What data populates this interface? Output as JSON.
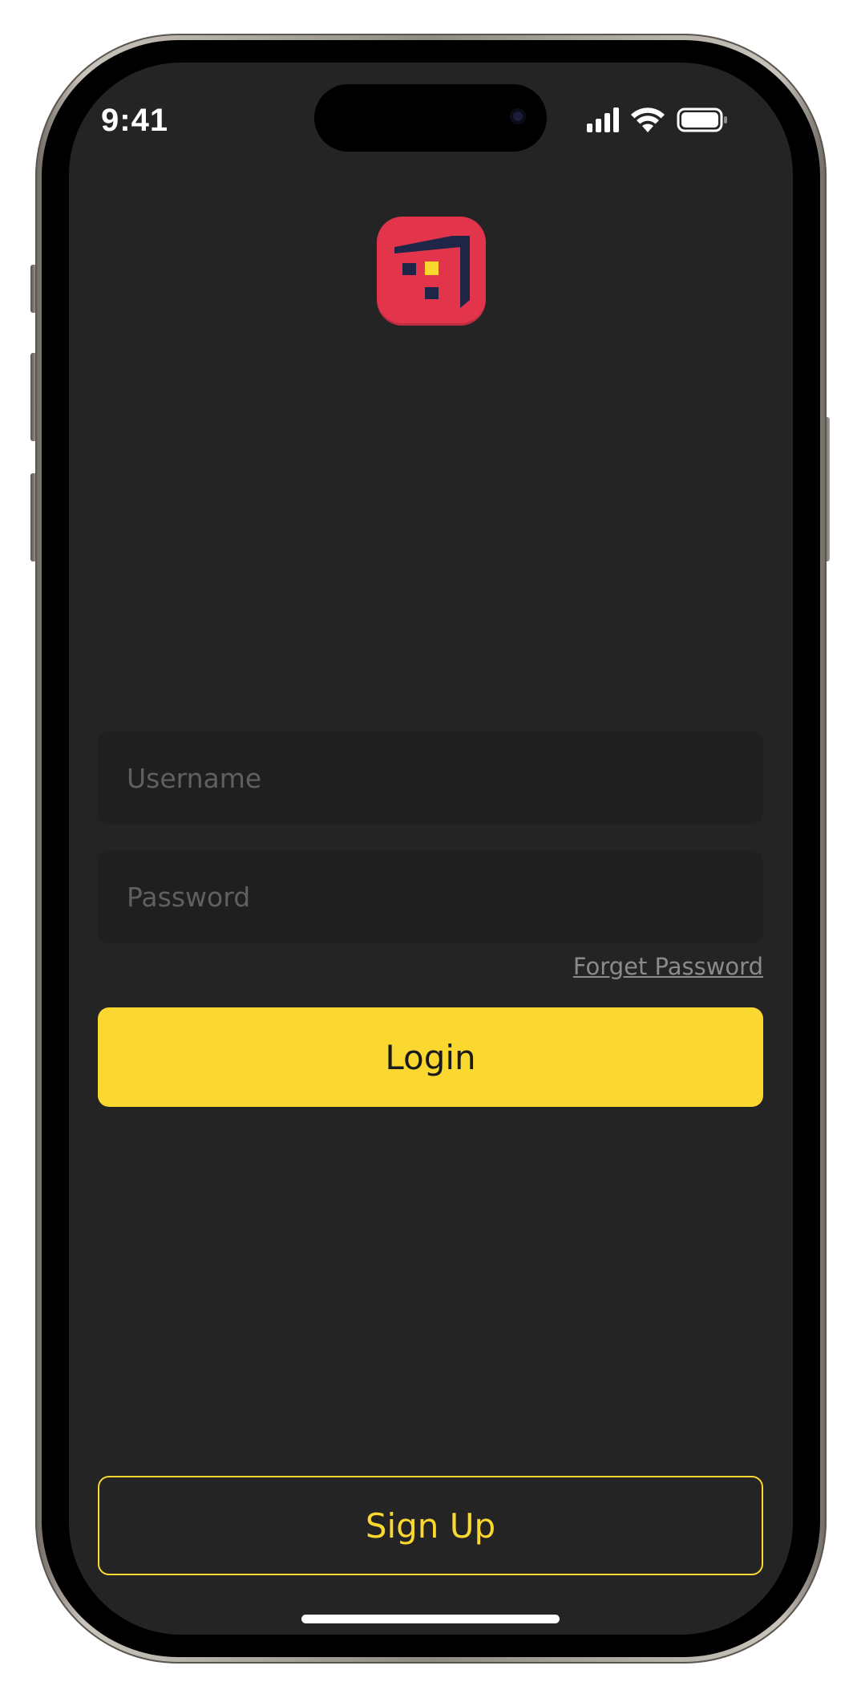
{
  "status_bar": {
    "time": "9:41",
    "icons": [
      "cellular-signal-icon",
      "wifi-icon",
      "battery-icon"
    ]
  },
  "logo": {
    "icon": "app-logo-icon",
    "colors": {
      "background": "#e2354b",
      "mark": "#1f2547",
      "accent": "#fbd82f"
    }
  },
  "login_form": {
    "username": {
      "value": "",
      "placeholder": "Username"
    },
    "password": {
      "value": "",
      "placeholder": "Password"
    },
    "forget_password_label": "Forget Password",
    "login_label": "Login"
  },
  "signup_label": "Sign Up",
  "colors": {
    "screen_background": "#242424",
    "field_background": "#1e1f1e",
    "accent": "#fbd82f"
  }
}
